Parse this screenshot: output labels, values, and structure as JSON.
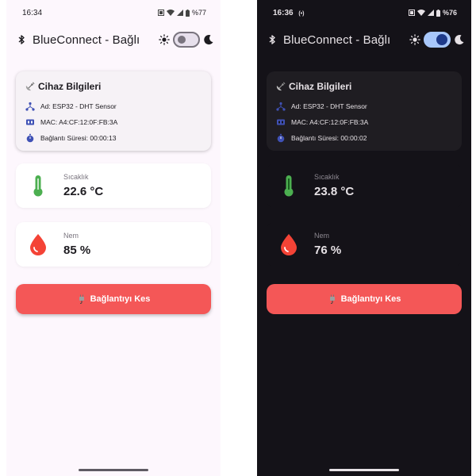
{
  "light": {
    "status": {
      "time": "16:34",
      "extra": "",
      "battery": "%77"
    },
    "appbar": {
      "title": "BlueConnect - Bağlı",
      "theme_toggle_on": false
    },
    "info_card": {
      "title": "Cihaz Bilgileri",
      "name": "Ad: ESP32 - DHT Sensor",
      "mac": "MAC: A4:CF:12:0F:FB:3A",
      "duration": "Bağlantı Süresi: 00:00:13"
    },
    "temperature": {
      "label": "Sıcaklık",
      "value": "22.6 °C"
    },
    "humidity": {
      "label": "Nem",
      "value": "85 %"
    },
    "disconnect_label": "Bağlantıyı Kes"
  },
  "dark": {
    "status": {
      "time": "16:36",
      "extra": "(•)",
      "battery": "%76"
    },
    "appbar": {
      "title": "BlueConnect - Bağlı",
      "theme_toggle_on": true
    },
    "info_card": {
      "title": "Cihaz Bilgileri",
      "name": "Ad: ESP32 - DHT Sensor",
      "mac": "MAC: A4:CF:12:0F:FB:3A",
      "duration": "Bağlantı Süresi: 00:00:02"
    },
    "temperature": {
      "label": "Sıcaklık",
      "value": "23.8 °C"
    },
    "humidity": {
      "label": "Nem",
      "value": "76 %"
    },
    "disconnect_label": "Bağlantıyı Kes"
  },
  "colors": {
    "accent_icon": "#3f51b5",
    "thermometer": "#4caf50",
    "drop": "#f44336",
    "disconnect_bg": "#f45757"
  },
  "icons": [
    "bluetooth-icon",
    "sun-icon",
    "moon-icon",
    "satellite-antenna-icon",
    "network-icon",
    "chip-icon",
    "stopwatch-icon",
    "thermometer-icon",
    "drop-icon",
    "plug-icon"
  ]
}
